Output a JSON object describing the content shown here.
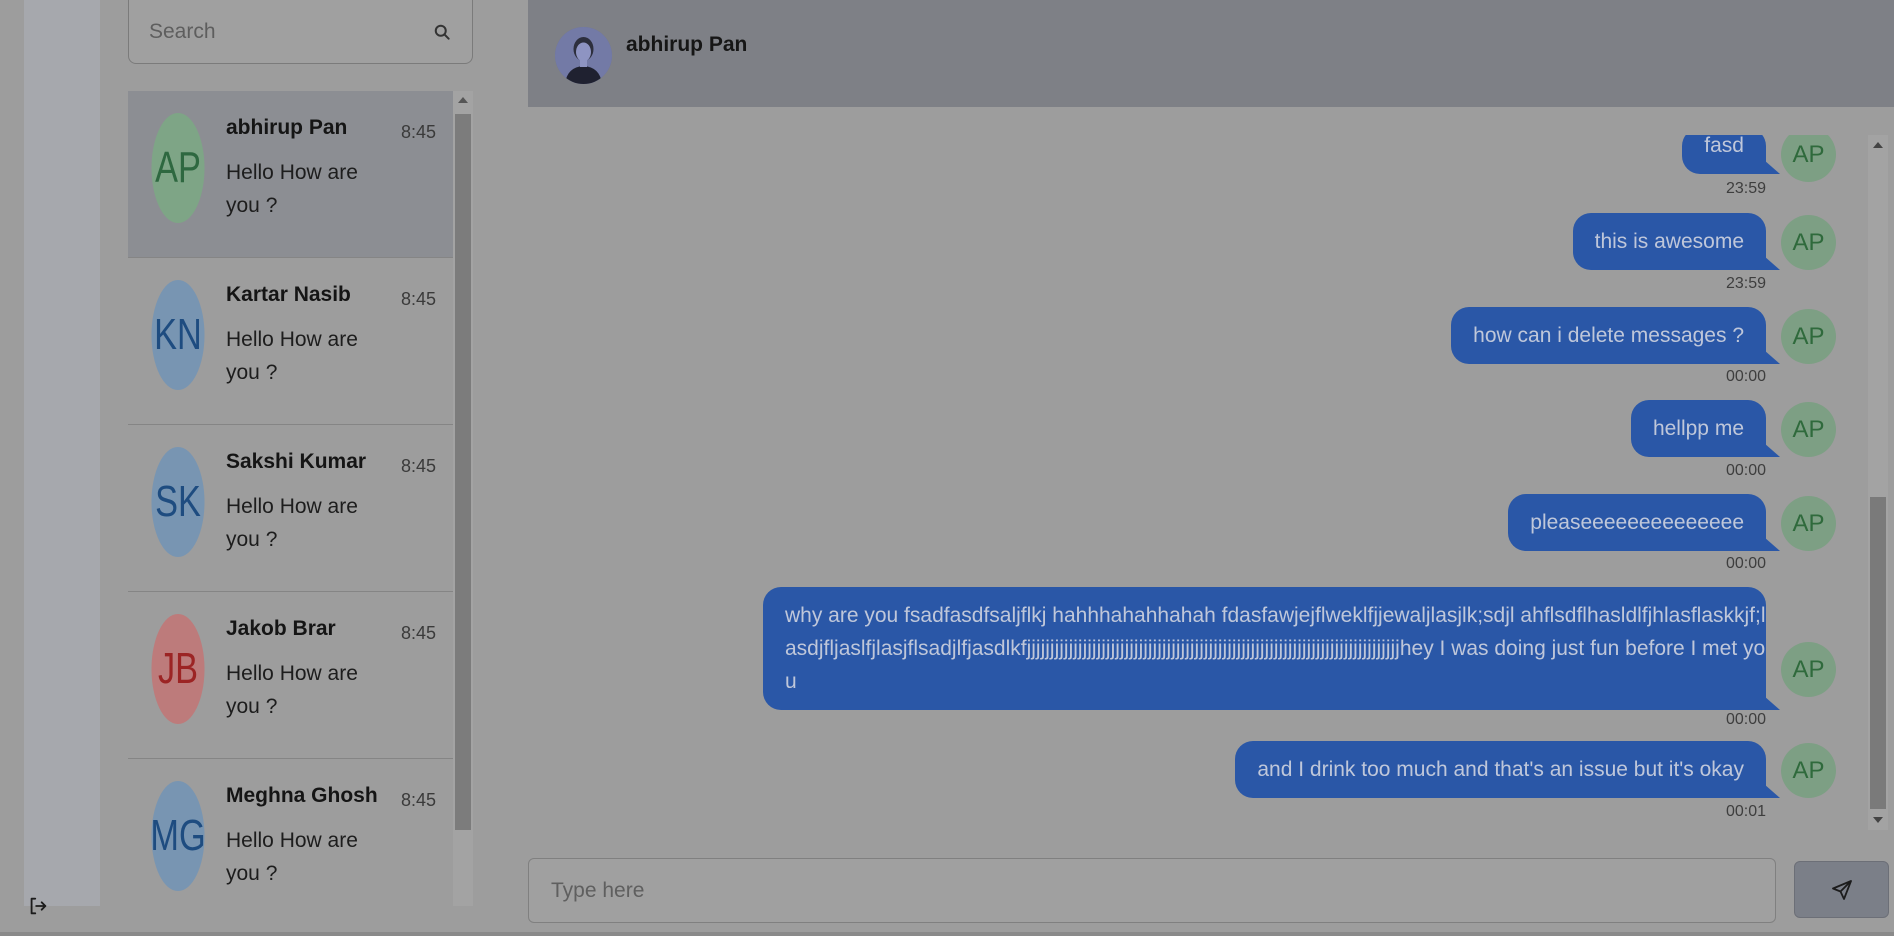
{
  "search": {
    "placeholder": "Search"
  },
  "contacts": [
    {
      "initials": "AP",
      "name": "abhirup Pan",
      "message": "Hello How are you ?",
      "time": "8:45",
      "avatar_bg": "#7ea586",
      "avatar_fg": "#2e6840"
    },
    {
      "initials": "KN",
      "name": "Kartar Nasib",
      "message": "Hello How are you ?",
      "time": "8:45",
      "avatar_bg": "#7895b2",
      "avatar_fg": "#1e4c80"
    },
    {
      "initials": "SK",
      "name": "Sakshi Kumar",
      "message": "Hello How are you ?",
      "time": "8:45",
      "avatar_bg": "#7895b2",
      "avatar_fg": "#1e4c80"
    },
    {
      "initials": "JB",
      "name": "Jakob Brar",
      "message": "Hello How are you ?",
      "time": "8:45",
      "avatar_bg": "#bd7b7b",
      "avatar_fg": "#9c2424"
    },
    {
      "initials": "MG",
      "name": "Meghna Ghosh",
      "message": "Hello How are you ?",
      "time": "8:45",
      "avatar_bg": "#7895b2",
      "avatar_fg": "#1e4c80"
    }
  ],
  "chat": {
    "name": "abhirup Pan",
    "avatar_initials": "AP",
    "messages": [
      {
        "text": "fasd",
        "time": "23:59"
      },
      {
        "text": "this is awesome",
        "time": "23:59"
      },
      {
        "text": "how can i delete messages ?",
        "time": "00:00"
      },
      {
        "text": "hellpp me",
        "time": "00:00"
      },
      {
        "text": "pleaseeeeeeeeeeeeee",
        "time": "00:00"
      },
      {
        "text": "why are you fsadfasdfsaljflkj hahhhahahhahah fdasfawjejflweklfjjewaljlasjlk;sdjl ahflsdflhasldlfjhlasflaskkjf;lasdjfljaslfjlasjflsadjlfjasdlkfjjjjjjjjjjjjjjjjjjjjjjjjjjjjjjjjjjjjjjjjjjjjjjjjjjjjjjjjjjjjjjjjjjjjjjjjjjjjjjjjhey I was doing just fun before I met you",
        "time": "00:00"
      },
      {
        "text": "and I drink too much and that's an issue but it's okay",
        "time": "00:01"
      }
    ]
  },
  "composer": {
    "placeholder": "Type here"
  },
  "icons": {
    "logout": "logout-icon",
    "search": "search-icon",
    "send": "send-icon"
  }
}
